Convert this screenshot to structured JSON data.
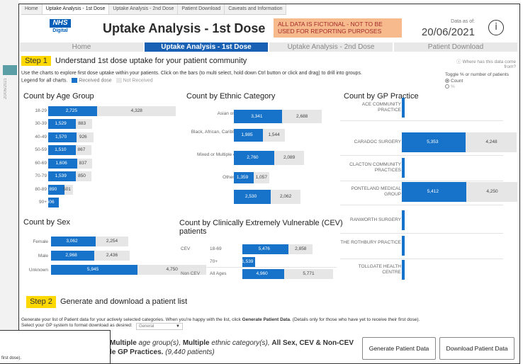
{
  "tabs": [
    "Home",
    "Uptake Analysis - 1st Dose",
    "Uptake Analysis - 2nd Dose",
    "Patient Download",
    "Caveats and Information"
  ],
  "logo": {
    "text": "NHS",
    "sub": "Digital"
  },
  "title": "Uptake Analysis - 1st Dose",
  "warning": "ALL DATA IS FICTIONAL - NOT TO BE USED FOR REPORTING PURPOSES",
  "as_of_label": "Data as of:",
  "as_of_date": "20/06/2021",
  "info_icon": "i",
  "nav": [
    "Home",
    "Uptake Analysis - 1st Dose",
    "Uptake Analysis - 2nd Dose",
    "Patient Download"
  ],
  "step1": {
    "badge": "Step 1",
    "title": "Understand 1st dose uptake for your patient community",
    "instructions": "Use the charts to explore first dose uptake within your patients. Click on the bars (to multi select, hold down Ctrl button or click and drag) to drill into groups.",
    "legend_label": "Legend for all charts.",
    "legend_received": "Received dose",
    "legend_not": "Not Received"
  },
  "toggle": {
    "where_link": "Where has this data come from?",
    "label": "Toggle % or number of patients",
    "options": [
      "Count",
      "%"
    ],
    "selected": "Count"
  },
  "colors": {
    "received": "#1773c9",
    "not_received": "#e6e6e6",
    "step": "#ffd800",
    "nav_active": "#1760b4",
    "warning_bg": "#f7ba8d"
  },
  "chart_data": [
    {
      "type": "bar",
      "title": "Count by Age Group",
      "categories": [
        "18-29",
        "30-39",
        "40-49",
        "50-59",
        "60-69",
        "70-79",
        "80-89",
        "90+"
      ],
      "series": [
        {
          "name": "Received dose",
          "values": [
            2725,
            1529,
            1570,
            1510,
            1606,
            1539,
            890,
            606
          ]
        },
        {
          "name": "Not Received",
          "values": [
            4328,
            883,
            926,
            867,
            837,
            850,
            501,
            null
          ]
        }
      ],
      "labels": [
        [
          "2,725",
          "4,328"
        ],
        [
          "1,529",
          "883"
        ],
        [
          "1,570",
          "926"
        ],
        [
          "1,510",
          "867"
        ],
        [
          "1,606",
          "837"
        ],
        [
          "1,539",
          "850"
        ],
        [
          "890",
          "501"
        ],
        [
          "606",
          ""
        ]
      ]
    },
    {
      "type": "bar",
      "title": "Count by Ethnic Category",
      "categories": [
        "Asian or Asian British",
        "Black, African, Caribbean or Black British",
        "Mixed or Multiple ethnic groups",
        "Other ethnic group",
        "White"
      ],
      "series": [
        {
          "name": "Received dose",
          "values": [
            3341,
            1985,
            2760,
            1359,
            2530
          ]
        },
        {
          "name": "Not Received",
          "values": [
            2688,
            1544,
            2089,
            1057,
            2062
          ]
        }
      ],
      "labels": [
        [
          "3,341",
          "2,688"
        ],
        [
          "1,985",
          "1,544"
        ],
        [
          "2,760",
          "2,089"
        ],
        [
          "1,359",
          "1,057"
        ],
        [
          "2,530",
          "2,062"
        ]
      ]
    },
    {
      "type": "bar",
      "title": "Count by GP Practice",
      "categories": [
        "ACE COMMUNITY PRACTICE",
        "CARADOC SURGERY",
        "CLACTON COMMUNITY PRACTICES",
        "PONTELAND MEDICAL GROUP",
        "RANWORTH SURGERY",
        "THE ROTHBURY PRACTICE",
        "TOLLGATE HEALTH CENTRE"
      ],
      "series": [
        {
          "name": "Received dose",
          "values": [
            null,
            5353,
            null,
            5412,
            null,
            null,
            null
          ]
        },
        {
          "name": "Not Received",
          "values": [
            null,
            4248,
            null,
            4250,
            null,
            null,
            null
          ]
        }
      ],
      "labels": [
        [
          "",
          ""
        ],
        [
          "5,353",
          "4,248"
        ],
        [
          "",
          ""
        ],
        [
          "5,412",
          "4,250"
        ],
        [
          "",
          ""
        ],
        [
          "",
          ""
        ],
        [
          "",
          ""
        ]
      ]
    },
    {
      "type": "bar",
      "title": "Count by Sex",
      "categories": [
        "Female",
        "Male",
        "Unknown"
      ],
      "series": [
        {
          "name": "Received dose",
          "values": [
            3062,
            2968,
            5945
          ]
        },
        {
          "name": "Not Received",
          "values": [
            2254,
            2436,
            4750
          ]
        }
      ],
      "labels": [
        [
          "3,062",
          "2,254"
        ],
        [
          "2,968",
          "2,436"
        ],
        [
          "5,945",
          "4,750"
        ]
      ]
    },
    {
      "type": "bar",
      "title": "Count by Clinically Extremely Vulnerable (CEV) patients",
      "groups": [
        "CEV",
        "",
        "Non CEV"
      ],
      "categories": [
        "18-69",
        "70+",
        "All Ages"
      ],
      "series": [
        {
          "name": "Received dose",
          "values": [
            5476,
            1539,
            4960
          ]
        },
        {
          "name": "Not Received",
          "values": [
            2858,
            null,
            5771
          ]
        }
      ],
      "labels": [
        [
          "5,476",
          "2,858"
        ],
        [
          "1,539",
          ""
        ],
        [
          "4,960",
          "5,771"
        ]
      ]
    }
  ],
  "step2": {
    "badge": "Step 2",
    "title": "Generate and download a patient list",
    "instructions": "Generate your list of Patient data for your actively selected categories. When you're happy with the list, click",
    "instructions_bold": "Generate Patient Data",
    "instructions_end": ". (Details only for those who have yet to receive their first dose).",
    "select_label": "Select your GP system to format download as desired:",
    "select_value": "General",
    "summary_line1": [
      "Multiple",
      " age group(s), ",
      "Multiple",
      " ethnic category(s), ",
      "All Sex, CEV & Non-CEV"
    ],
    "summary_line2": [
      "le GP Practices.",
      " (9,440 patients)"
    ],
    "generate_button": "Generate Patient Data",
    "download_button": "Download Patient Data",
    "overlay_text": "first dose)."
  },
  "bg": {
    "side_text": "20/06/2021"
  }
}
